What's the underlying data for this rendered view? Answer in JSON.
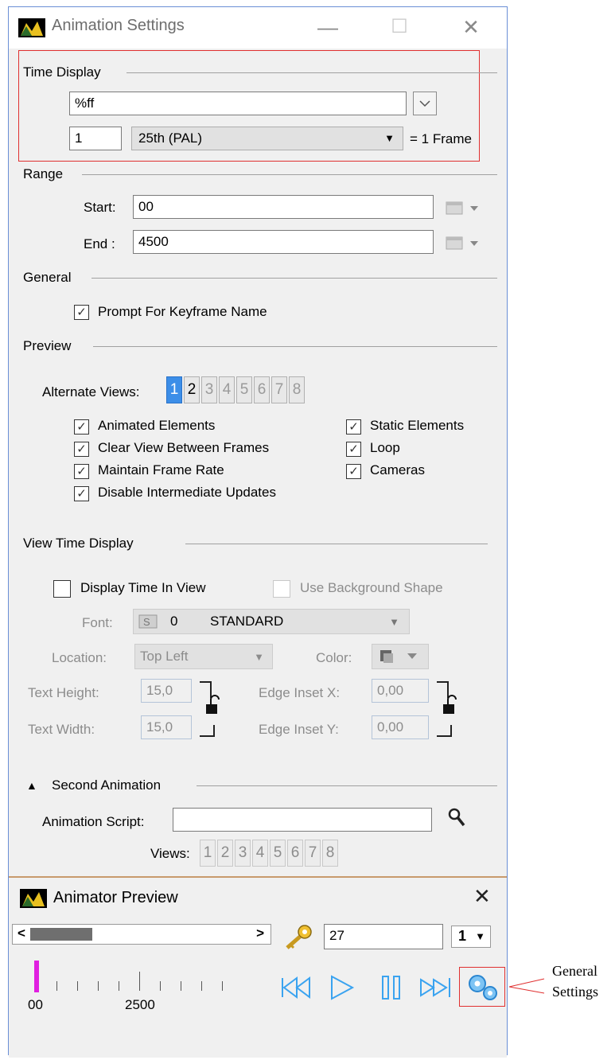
{
  "window": {
    "title": "Animation Settings",
    "minimize": "—",
    "maximize": "☐",
    "close": "✕"
  },
  "time_display": {
    "heading": "Time Display",
    "format_value": "%ff",
    "frame_count": "1",
    "frame_rate": "25th (PAL)",
    "equals_label": "= 1 Frame"
  },
  "range": {
    "heading": "Range",
    "start_label": "Start:",
    "start_value": "00",
    "end_label": "End :",
    "end_value": "4500"
  },
  "general": {
    "heading": "General",
    "prompt_keyframe": "Prompt For Keyframe Name"
  },
  "preview": {
    "heading": "Preview",
    "alternate_views_label": "Alternate Views:",
    "views": [
      "1",
      "2",
      "3",
      "4",
      "5",
      "6",
      "7",
      "8"
    ],
    "options_left": [
      "Animated Elements",
      "Clear View Between Frames",
      "Maintain Frame Rate",
      "Disable Intermediate Updates"
    ],
    "options_right": [
      "Static Elements",
      "Loop",
      "Cameras"
    ]
  },
  "view_time_display": {
    "heading": "View Time Display",
    "display_time": "Display Time In View",
    "use_bg_shape": "Use Background Shape",
    "font_label": "Font:",
    "font_num": "0",
    "font_name": "STANDARD",
    "location_label": "Location:",
    "location_value": "Top Left",
    "color_label": "Color:",
    "text_height_label": "Text Height:",
    "text_height": "15,0",
    "text_width_label": "Text Width:",
    "text_width": "15,0",
    "edge_x_label": "Edge Inset X:",
    "edge_x": "0,00",
    "edge_y_label": "Edge Inset Y:",
    "edge_y": "0,00"
  },
  "second_animation": {
    "heading": "Second Animation",
    "script_label": "Animation Script:",
    "script_value": "",
    "views_label": "Views:",
    "views": [
      "1",
      "2",
      "3",
      "4",
      "5",
      "6",
      "7",
      "8"
    ]
  },
  "animator_preview": {
    "title": "Animator Preview",
    "close": "✕",
    "frame_value": "27",
    "step_value": "1",
    "scroll_left": "<",
    "scroll_right": ">",
    "ruler_start": "00",
    "ruler_mid": "2500"
  },
  "callout": {
    "label_line1": "General",
    "label_line2": "Settings"
  },
  "colors": {
    "accent": "#3c8ee8",
    "media_blue": "#3aa3f0",
    "highlight_red": "#e03030",
    "playhead": "#e020e0"
  }
}
